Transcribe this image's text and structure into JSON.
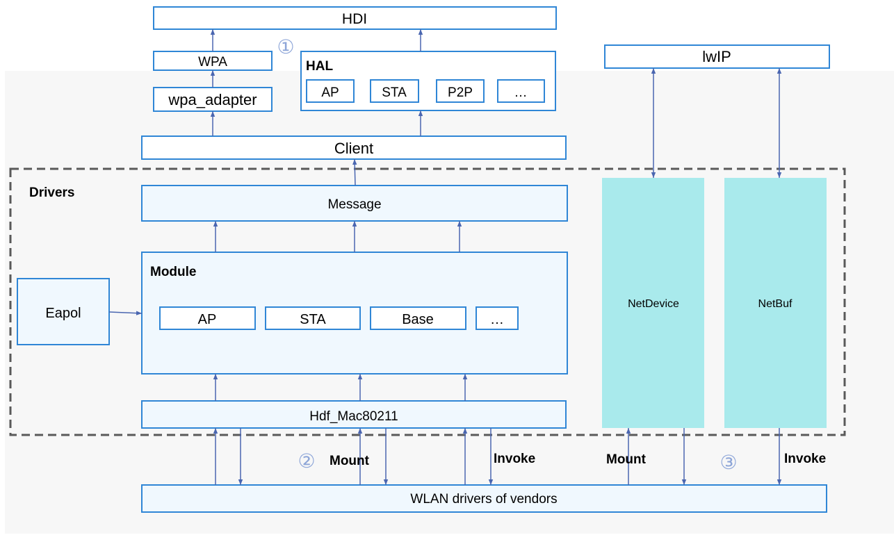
{
  "colors": {
    "border": "#2f86d6",
    "arrow": "#4a66b0",
    "fill": "#f0f8fe",
    "teal": "#a9eaec",
    "bg": "#f7f7f7",
    "dashed": "#595959",
    "circle": "#8ea6d8"
  },
  "top": {
    "hdi": "HDI",
    "wpa": "WPA",
    "wpa_adapter": "wpa_adapter",
    "hal": "HAL",
    "hal_items": [
      "AP",
      "STA",
      "P2P",
      "…"
    ],
    "client": "Client",
    "lwip": "lwIP",
    "marker1": "①"
  },
  "drivers": {
    "title": "Drivers",
    "message": "Message",
    "module": "Module",
    "module_items": [
      "AP",
      "STA",
      "Base",
      "…"
    ],
    "eapol": "Eapol",
    "hdf": "Hdf_Mac80211",
    "netdevice": "NetDevice",
    "netbuf": "NetBuf"
  },
  "bottom": {
    "wlan": "WLAN drivers of vendors",
    "marker2": "②",
    "mount1": "Mount",
    "invoke1": "Invoke",
    "mount2": "Mount",
    "marker3": "③",
    "invoke2": "Invoke"
  }
}
